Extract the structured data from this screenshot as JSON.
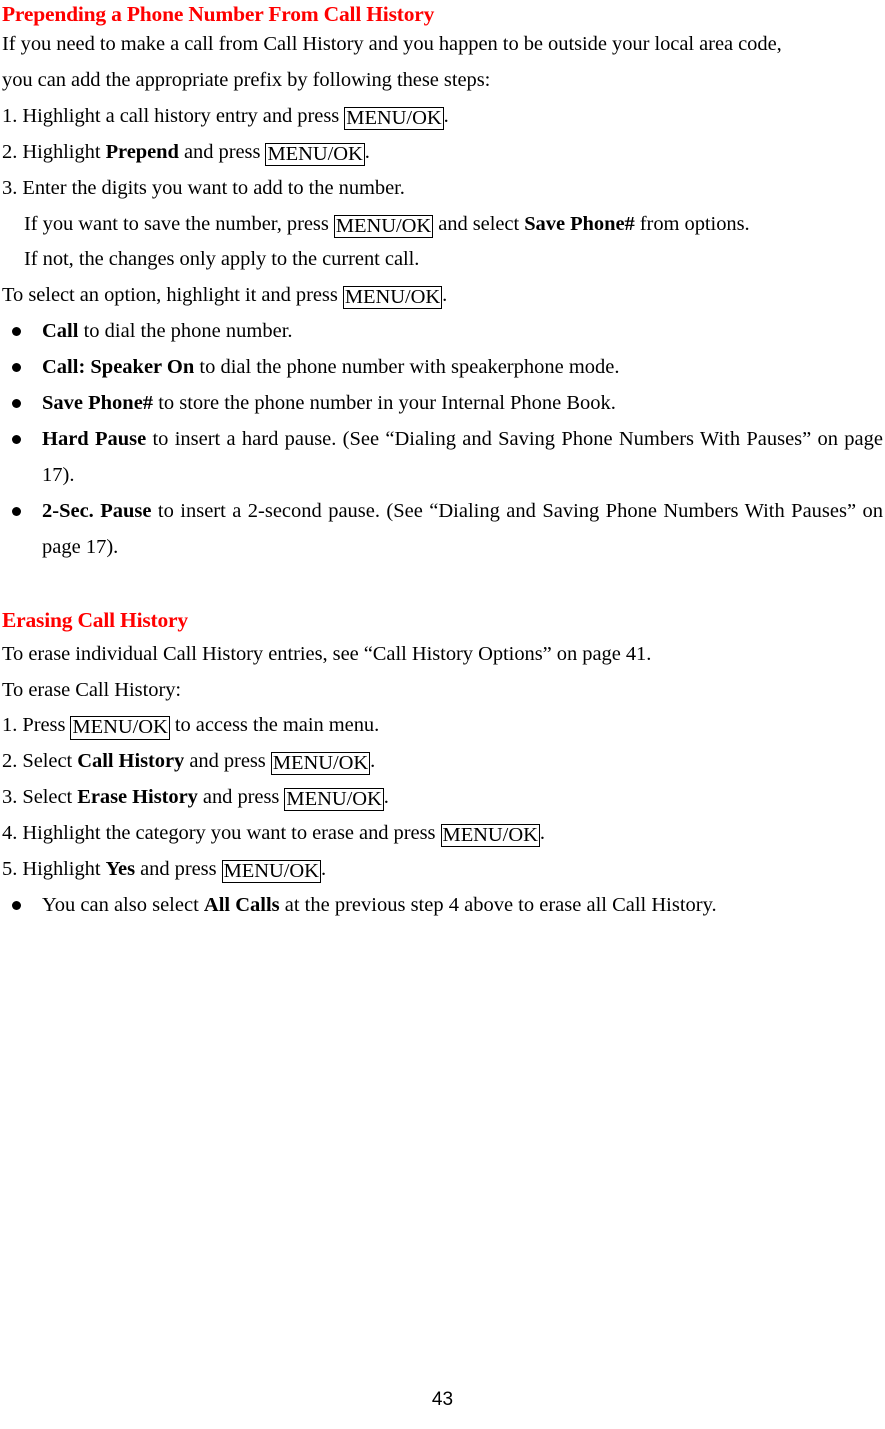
{
  "document": {
    "page_number": "43",
    "heading_color": "#FF0000",
    "text_color": "#000000"
  },
  "section_1": {
    "heading": "Prepending a Phone Number From Call History",
    "intro": {
      "line_1": "If you need to make a call from Call History and you happen to be outside your local area code,",
      "line_2": "you can add the appropriate prefix by following these steps:"
    },
    "steps": [
      {
        "number": "1.",
        "prefix": "Highlight a call history entry and press ",
        "key": "MENU/OK",
        "suffix": "."
      },
      {
        "number": "2.",
        "prefix": "Highlight ",
        "bold": "Prepend",
        "mid": " and press ",
        "key": "MENU/OK",
        "suffix": "."
      },
      {
        "number": "3.",
        "prefix": "Enter the digits you want to add to the number.",
        "key": "",
        "suffix": ""
      }
    ],
    "step3_sub": [
      {
        "prefix": "If you want to save the number, press ",
        "key": "MENU/OK",
        "mid": " and select ",
        "bold": "Save Phone#",
        "suffix": " from options."
      },
      {
        "prefix": "If not, the changes only apply to the current call.",
        "key": "",
        "mid": "",
        "bold": "",
        "suffix": ""
      }
    ],
    "select_line": {
      "prefix": "To select an option, highlight it and press ",
      "key": "MENU/OK",
      "suffix": "."
    },
    "options": [
      {
        "bold": "Call",
        "rest": " to dial the phone number.",
        "justify": false
      },
      {
        "bold": "Call: Speaker On",
        "rest": " to dial the phone number with speakerphone mode.",
        "justify": false
      },
      {
        "bold": "Save Phone#",
        "rest": " to store the phone number in your Internal Phone Book.",
        "justify": false
      },
      {
        "bold": "Hard Pause",
        "rest": " to insert a hard pause. (See “Dialing and Saving Phone Numbers With Pauses” on page 17).",
        "justify": true
      },
      {
        "bold": "2-Sec. Pause",
        "rest": " to insert a 2-second pause. (See “Dialing and Saving Phone Numbers With Pauses” on page 17).",
        "justify": true
      }
    ]
  },
  "section_2": {
    "heading": "Erasing Call History",
    "intro_line": "To erase individual Call History entries, see “Call History Options” on page 41.",
    "lead_line": "To erase Call History:",
    "steps": [
      {
        "number": "1.",
        "prefix": "Press ",
        "key": "MENU/OK",
        "mid": " to access the main menu.",
        "bold": "",
        "suffix": ""
      },
      {
        "number": "2.",
        "prefix": "Select ",
        "bold": "Call History",
        "mid": " and press ",
        "key": "MENU/OK",
        "suffix": "."
      },
      {
        "number": "3.",
        "prefix": "Select ",
        "bold": "Erase History",
        "mid": " and press ",
        "key": "MENU/OK",
        "suffix": "."
      },
      {
        "number": "4.",
        "prefix": "Highlight the category you want to erase and press ",
        "bold": "",
        "mid": "",
        "key": "MENU/OK",
        "suffix": "."
      },
      {
        "number": "5.",
        "prefix": "Highlight ",
        "bold": "Yes",
        "mid": " and press ",
        "key": "MENU/OK",
        "suffix": "."
      }
    ],
    "note_bullet": {
      "prefix": "You can also select ",
      "bold": "All Calls",
      "suffix": " at the previous step 4 above to erase all Call History."
    }
  }
}
